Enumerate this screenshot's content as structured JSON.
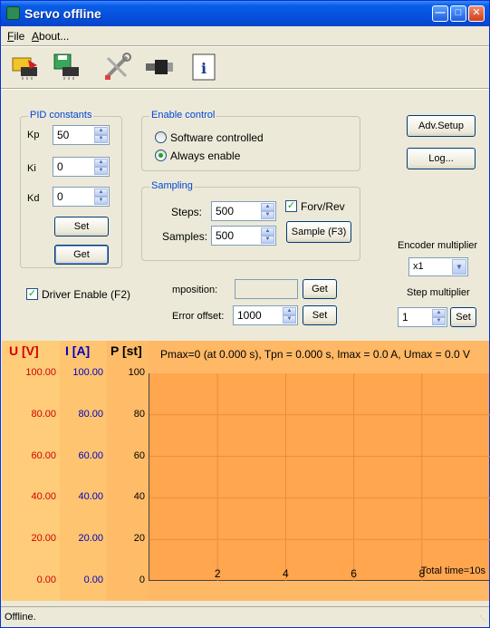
{
  "window": {
    "title": "Servo offline"
  },
  "menu": [
    {
      "label": "File",
      "accel": "F",
      "rest": "ile"
    },
    {
      "label": "About...",
      "accel": "A",
      "rest": "bout..."
    }
  ],
  "toolbar": {
    "icons": [
      "load-chip-icon",
      "save-chip-icon",
      "tools-icon",
      "connector-icon",
      "info-icon"
    ],
    "info_glyph": "i"
  },
  "pid": {
    "title": "PID constants",
    "kp_label": "Kp",
    "kp_value": "50",
    "ki_label": "Ki",
    "ki_value": "0",
    "kd_label": "Kd",
    "kd_value": "0",
    "set_label": "Set",
    "get_label": "Get"
  },
  "enable": {
    "title": "Enable control",
    "software_label": "Software controlled",
    "always_label": "Always enable",
    "selected": "always"
  },
  "sampling": {
    "title": "Sampling",
    "steps_label": "Steps:",
    "steps_value": "500",
    "samples_label": "Samples:",
    "samples_value": "500",
    "forvrev_label": "Forv/Rev",
    "forvrev_checked": true,
    "sample_button": "Sample (F3)"
  },
  "right": {
    "adv_setup": "Adv.Setup",
    "log": "Log...",
    "encoder_label": "Encoder multiplier",
    "encoder_value": "x1",
    "step_label": "Step multiplier",
    "step_value": "1",
    "step_set": "Set"
  },
  "driver": {
    "label": "Driver Enable (F2)",
    "checked": true
  },
  "mposition": {
    "label": "mposition:",
    "value": "",
    "get": "Get",
    "error_label": "Error offset:",
    "error_value": "1000",
    "set": "Set"
  },
  "chart_data": {
    "type": "line",
    "title": "Pmax=0 (at  0.000 s), Tpn = 0.000  s, Imax =  0.0 A, Umax = 0.0  V",
    "axes": [
      {
        "label": "U [V]",
        "ticks": [
          "100.00",
          "80.00",
          "60.00",
          "40.00",
          "20.00",
          "0.00"
        ],
        "ylim": [
          0,
          100
        ],
        "color": "#d00000"
      },
      {
        "label": "I [A]",
        "ticks": [
          "100.00",
          "80.00",
          "60.00",
          "40.00",
          "20.00",
          "0.00"
        ],
        "ylim": [
          0,
          100
        ],
        "color": "#0000c0"
      },
      {
        "label": "P [st]",
        "ticks": [
          "100",
          "80",
          "60",
          "40",
          "20",
          "0"
        ],
        "ylim": [
          0,
          100
        ],
        "color": "#000000"
      }
    ],
    "x_ticks": [
      "2",
      "4",
      "6",
      "8"
    ],
    "x_tick_values": [
      2,
      4,
      6,
      8
    ],
    "xlim": [
      0,
      10
    ],
    "annotation": "Total time=10s",
    "series": [],
    "grid": true
  },
  "status": {
    "text": "Offline."
  }
}
